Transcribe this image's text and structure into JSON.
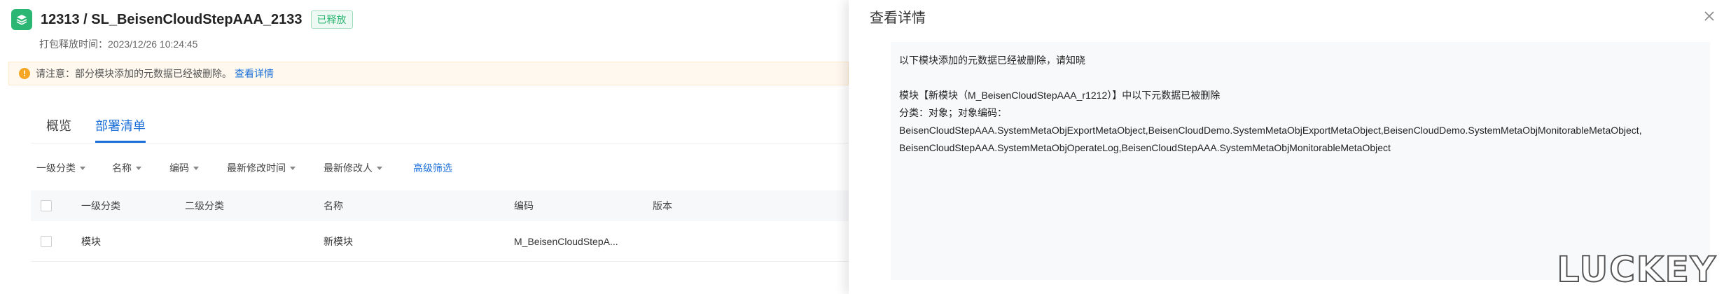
{
  "header": {
    "title": "12313 / SL_BeisenCloudStepAAA_2133",
    "status": "已释放",
    "publish_time": "打包释放时间：2023/12/26 10:24:45"
  },
  "notice": {
    "text": "请注意：部分模块添加的元数据已经被删除。",
    "link": "查看详情"
  },
  "tabs": [
    {
      "label": "概览"
    },
    {
      "label": "部署清单"
    }
  ],
  "filters": {
    "items": [
      "一级分类",
      "名称",
      "编码",
      "最新修改时间",
      "最新修改人"
    ],
    "advanced": "高级筛选"
  },
  "table": {
    "headers": [
      "一级分类",
      "二级分类",
      "名称",
      "编码",
      "版本"
    ],
    "rows": [
      {
        "level1": "模块",
        "level2": "",
        "name": "新模块",
        "code": "M_BeisenCloudStepA...",
        "version": ""
      }
    ]
  },
  "panel": {
    "title": "查看详情",
    "lines": [
      "以下模块添加的元数据已经被删除，请知晓",
      "模块【新模块（M_BeisenCloudStepAAA_r1212）】中以下元数据已被删除",
      "分类：对象；对象编码：",
      "BeisenCloudStepAAA.SystemMetaObjExportMetaObject,BeisenCloudDemo.SystemMetaObjExportMetaObject,BeisenCloudDemo.SystemMetaObjMonitorableMetaObject,",
      "BeisenCloudStepAAA.SystemMetaObjOperateLog,BeisenCloudStepAAA.SystemMetaObjMonitorableMetaObject"
    ]
  },
  "watermark": "LUCKEY",
  "colors": {
    "accent": "#1a6fd8",
    "success": "#2bb673",
    "warning": "#f5a623"
  },
  "icons": {
    "logo": "layers-icon",
    "notice": "warning-circle-icon",
    "close": "close-icon",
    "caret": "caret-down-icon"
  }
}
